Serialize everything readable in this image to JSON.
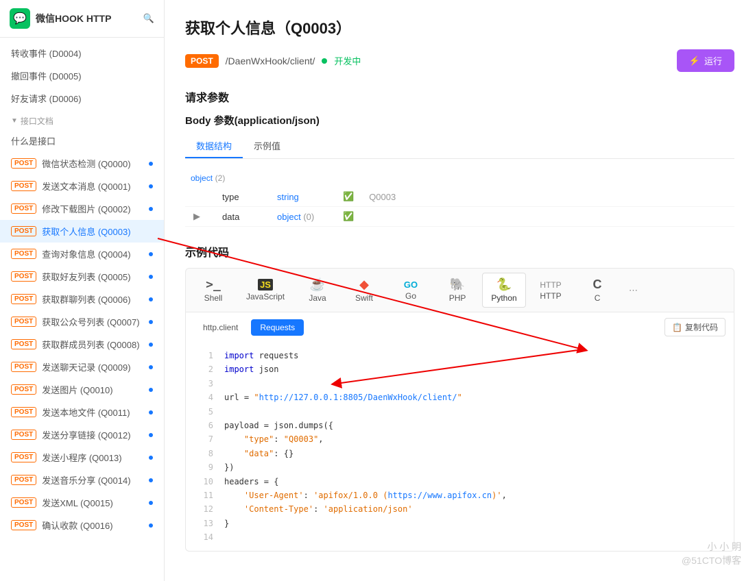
{
  "app": {
    "title": "微信HOOK HTTP",
    "logo_char": "💬"
  },
  "sidebar": {
    "search_title": "搜索",
    "section_label": "接口文档",
    "items_top": [
      {
        "label": "转收事件 (D0004)",
        "post": false
      },
      {
        "label": "撤回事件 (D0005)",
        "post": false
      },
      {
        "label": "好友请求 (D0006)",
        "post": false
      }
    ],
    "items": [
      {
        "id": "q0000",
        "label": "微信状态检测 (Q0000)",
        "post": true,
        "dot": true
      },
      {
        "id": "q0001",
        "label": "发送文本消息 (Q0001)",
        "post": true,
        "dot": true
      },
      {
        "id": "q0002",
        "label": "修改下载图片 (Q0002)",
        "post": true,
        "dot": true
      },
      {
        "id": "q0003",
        "label": "获取个人信息 (Q0003)",
        "post": true,
        "active": true
      },
      {
        "id": "q0004",
        "label": "查询对象信息 (Q0004)",
        "post": true,
        "dot": true
      },
      {
        "id": "q0005",
        "label": "获取好友列表 (Q0005)",
        "post": true,
        "dot": true
      },
      {
        "id": "q0006",
        "label": "获取群聊列表 (Q0006)",
        "post": true,
        "dot": true
      },
      {
        "id": "q0007",
        "label": "获取公众号列表 (Q0007)",
        "post": true,
        "dot": true
      },
      {
        "id": "q0008",
        "label": "获取群成员列表 (Q0008)",
        "post": true,
        "dot": true
      },
      {
        "id": "q0009",
        "label": "发送聊天记录 (Q0009)",
        "post": true,
        "dot": true
      },
      {
        "id": "q0010",
        "label": "发送图片 (Q0010)",
        "post": true,
        "dot": true
      },
      {
        "id": "q0011",
        "label": "发送本地文件 (Q0011)",
        "post": true,
        "dot": true
      },
      {
        "id": "q0012",
        "label": "发送分享链接 (Q0012)",
        "post": true,
        "dot": true
      },
      {
        "id": "q0013",
        "label": "发送小程序 (Q0013)",
        "post": true,
        "dot": true
      },
      {
        "id": "q0014",
        "label": "发送音乐分享 (Q0014)",
        "post": true,
        "dot": true
      },
      {
        "id": "q0015",
        "label": "发送XML (Q0015)",
        "post": true,
        "dot": true
      },
      {
        "id": "q0016",
        "label": "确认收款 (Q0016)",
        "post": true,
        "dot": true
      }
    ],
    "what_is_api": "什么是接口"
  },
  "main": {
    "title": "获取个人信息（Q0003）",
    "method": "POST",
    "path": "/DaenWxHook/client/",
    "status": "开发中",
    "run_label": "运行",
    "request_params_title": "请求参数",
    "body_params_title": "Body 参数(application/json)",
    "tabs": [
      "数据结构",
      "示例值"
    ],
    "active_tab": "数据结构",
    "object_label": "object",
    "object_count": "2",
    "fields": [
      {
        "name": "type",
        "type": "string",
        "default": "Q0003"
      },
      {
        "name": "data",
        "type": "object",
        "type_count": "0"
      }
    ],
    "example_code_title": "示例代码",
    "lang_tabs": [
      {
        "id": "shell",
        "label": "Shell",
        "icon": ">_"
      },
      {
        "id": "javascript",
        "label": "JavaScript",
        "icon": "JS"
      },
      {
        "id": "java",
        "label": "Java",
        "icon": "☕"
      },
      {
        "id": "swift",
        "label": "Swift",
        "icon": "◆"
      },
      {
        "id": "go",
        "label": "Go",
        "icon": "GO"
      },
      {
        "id": "php",
        "label": "PHP",
        "icon": "🐘"
      },
      {
        "id": "python",
        "label": "Python",
        "icon": "🐍",
        "active": true
      },
      {
        "id": "http",
        "label": "HTTP",
        "icon": "HTTP"
      },
      {
        "id": "c",
        "label": "C",
        "icon": "C"
      }
    ],
    "sub_tabs": [
      "http.client",
      "Requests"
    ],
    "active_sub_tab": "Requests",
    "copy_label": "复制代码",
    "code_lines": [
      {
        "num": 1,
        "content": "import requests"
      },
      {
        "num": 2,
        "content": "import json"
      },
      {
        "num": 3,
        "content": ""
      },
      {
        "num": 4,
        "content": "url = \"http://127.0.0.1:8805/DaenWxHook/client/\"",
        "has_url": true
      },
      {
        "num": 5,
        "content": ""
      },
      {
        "num": 6,
        "content": "payload = json.dumps({"
      },
      {
        "num": 7,
        "content": "    \"type\": \"Q0003\","
      },
      {
        "num": 8,
        "content": "    \"data\": {}"
      },
      {
        "num": 9,
        "content": "})"
      },
      {
        "num": 10,
        "content": "headers = {"
      },
      {
        "num": 11,
        "content": "    'User-Agent': 'apifox/1.0.0 (https://www.apifox.cn)',"
      },
      {
        "num": 12,
        "content": "    'Content-Type': 'application/json'"
      },
      {
        "num": 13,
        "content": "}"
      },
      {
        "num": 14,
        "content": ""
      }
    ],
    "watermark": "小 小 明\n@51CTO博客"
  }
}
